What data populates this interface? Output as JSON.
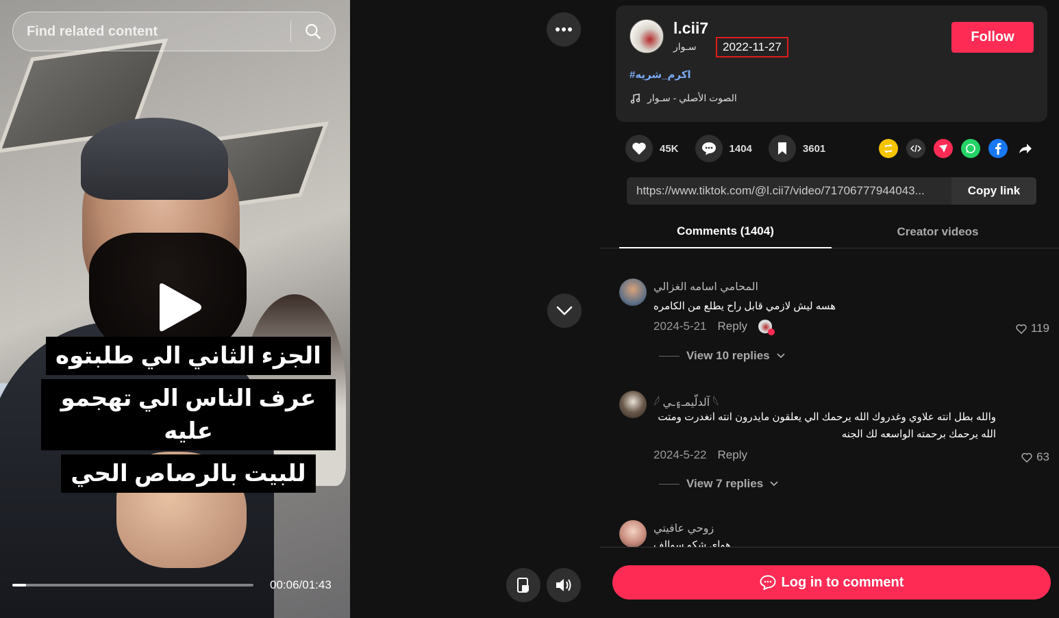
{
  "search": {
    "placeholder": "Find related content"
  },
  "video": {
    "caption_lines": [
      "الجزء الثاني الي طلبتوه",
      "عرف الناس الي تهجمو عليه",
      "للبيت بالرصاص الحي"
    ],
    "current_time": "00:06",
    "duration": "01:43",
    "time_display": "00:06/01:43",
    "progress_fraction": 0.058
  },
  "post": {
    "username": "l.cii7",
    "nickname": "ﺳـوار",
    "date": "2022-11-27",
    "follow_label": "Follow",
    "hashtag": "#اكرم_شريه",
    "music": "الصوت الأصلي - ﺳـوار"
  },
  "stats": {
    "likes": "45K",
    "comments": "1404",
    "saves": "3601"
  },
  "share": {
    "link": "https://www.tiktok.com/@l.cii7/video/71706777944043...",
    "copy_label": "Copy link"
  },
  "tabs": {
    "comments_label": "Comments (1404)",
    "creator_label": "Creator videos"
  },
  "comments": [
    {
      "name": "المحامي اسامه الغزالي",
      "text": "هسه ليش لازمي قابل راح يطلع من الكامره",
      "date": "2024-5-21",
      "reply_label": "Reply",
      "likes": "119",
      "view_replies": "View 10 replies"
    },
    {
      "name": "𓆩 آلدلّيمـ۽ـي 𓆪",
      "text": "والله بطل انته علاوي وغدروك الله يرحمك الي يعلقون مايدرون انته انغدرت ومتت الله يرحمك برحمته الواسعه لك الجنه",
      "date": "2024-5-22",
      "reply_label": "Reply",
      "likes": "63",
      "view_replies": "View 7 replies"
    },
    {
      "name": "زوحي عافيتي",
      "text": "هواي شكو سوالف"
    }
  ],
  "login": {
    "label": "Log in to comment"
  },
  "colors": {
    "brand": "#fe2c55",
    "highlight": "#e21b1b",
    "hashtag": "#79a9f2"
  }
}
